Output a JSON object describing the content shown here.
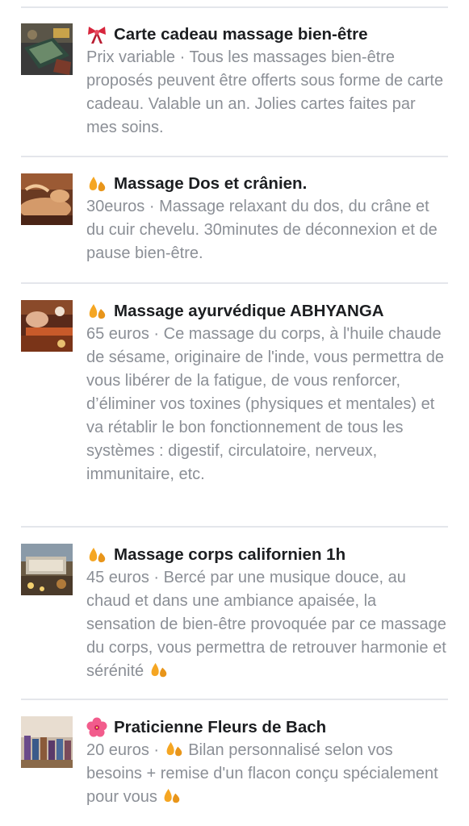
{
  "services": [
    {
      "icon": "gift-ribbon-icon",
      "title": "Carte cadeau massage bien-être",
      "price": "Prix variable",
      "separator": " · ",
      "description": "Tous les massages bien-être proposés peuvent être offerts sous forme de carte cadeau. Valable un an. Jolies cartes faites par mes soins.",
      "thumbnail": "gift-card-thumbnail"
    },
    {
      "icon": "drops-icon",
      "title": "Massage Dos et crânien.",
      "price": "30euros",
      "separator": " · ",
      "description": "Massage relaxant du dos, du crâne et du cuir chevelu. 30minutes de déconnexion et de pause bien-être.",
      "thumbnail": "back-massage-thumbnail"
    },
    {
      "icon": "drops-icon",
      "title": "Massage ayurvédique ABHYANGA",
      "price": "65 euros",
      "separator": " · ",
      "description": "Ce massage du corps, à l'huile chaude de sésame, originaire de l'inde, vous permettra de vous libérer de la fatigue, de vous renforcer, d’éliminer vos toxines (physiques et mentales) et va rétablir le bon fonctionnement de tous les systèmes : digestif, circulatoire, nerveux, immunitaire, etc.",
      "thumbnail": "ayurvedic-massage-thumbnail"
    },
    {
      "icon": "drops-icon",
      "title": "Massage corps californien 1h",
      "price": "45 euros",
      "separator": " · ",
      "description": "Bercé par une musique douce, au chaud et dans une ambiance apaisée, la sensation de bien-être provoquée par ce massage du corps, vous permettra de retrouver harmonie et sérénité",
      "thumbnail": "californian-massage-thumbnail"
    },
    {
      "icon": "hibiscus-icon",
      "title": "Praticienne Fleurs de Bach",
      "price": "20 euros",
      "separator": " · ",
      "description": "Bilan personnalisé selon vos besoins + remise d'un flacon conçu spécialement pour vous",
      "thumbnail": "bach-flowers-thumbnail"
    }
  ],
  "colors": {
    "title": "#1c1e21",
    "description": "#8b8f96",
    "divider": "#e4e6eb",
    "drops": "#f5a623",
    "ribbon": "#d7263d",
    "hibiscus": "#f25c8c"
  }
}
